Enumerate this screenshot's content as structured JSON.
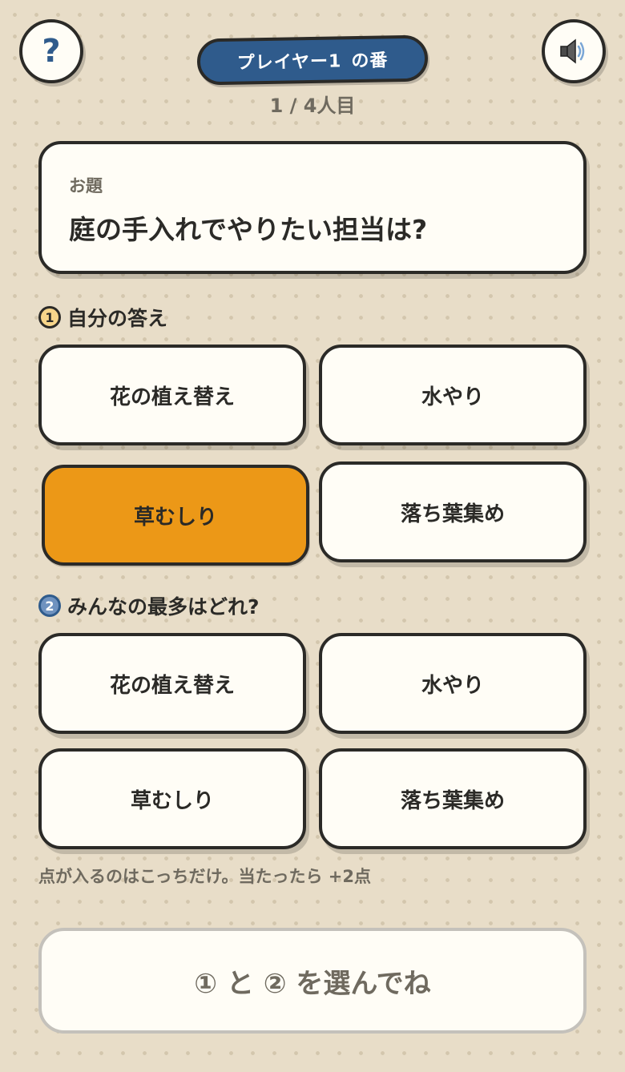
{
  "header": {
    "help_label": "?",
    "sound_icon": "speaker-icon",
    "turn_player": "プレイヤー1",
    "turn_suffix": "の番",
    "player_count": "1 / 4人目"
  },
  "topic": {
    "label": "お題",
    "text": "庭の手入れでやりたい担当は?"
  },
  "section1": {
    "badge": "1",
    "title": "自分の答え",
    "options": [
      "花の植え替え",
      "水やり",
      "草むしり",
      "落ち葉集め"
    ],
    "selected": "草むしり"
  },
  "section2": {
    "badge": "2",
    "title": "みんなの最多はどれ?",
    "options": [
      "花の植え替え",
      "水やり",
      "草むしり",
      "落ち葉集め"
    ]
  },
  "note": "点が入るのはこっちだけ。当たったら +2点",
  "submit_label": "① と ② を選んでね",
  "colors": {
    "accent_blue": "#2f5b8c",
    "selected_orange": "#ec9817",
    "background": "#e8ddc8"
  }
}
